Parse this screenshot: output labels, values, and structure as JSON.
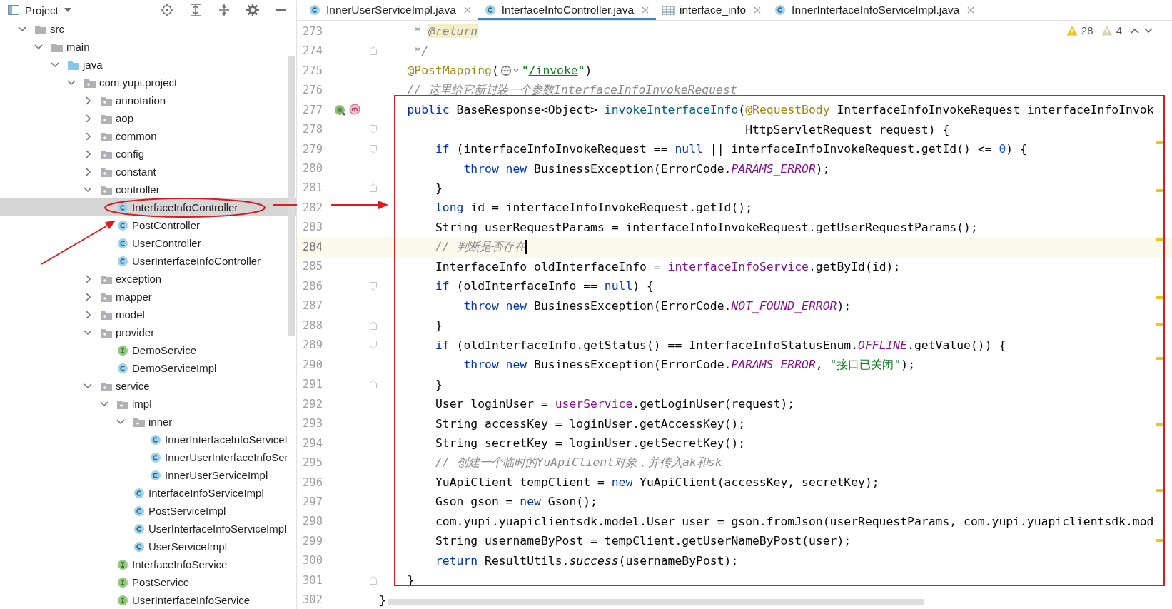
{
  "project_panel": {
    "title": "Project"
  },
  "tree": [
    {
      "label": "src",
      "kind": "folder",
      "expanded": true,
      "selected": false,
      "children": [
        {
          "label": "main",
          "kind": "folder",
          "expanded": true,
          "selected": false,
          "children": [
            {
              "label": "java",
              "kind": "source",
              "expanded": true,
              "selected": false,
              "children": [
                {
                  "label": "com.yupi.project",
                  "kind": "package",
                  "expanded": true,
                  "selected": false,
                  "children": [
                    {
                      "label": "annotation",
                      "kind": "package",
                      "expanded": false,
                      "selected": false
                    },
                    {
                      "label": "aop",
                      "kind": "package",
                      "expanded": false,
                      "selected": false
                    },
                    {
                      "label": "common",
                      "kind": "package",
                      "expanded": false,
                      "selected": false
                    },
                    {
                      "label": "config",
                      "kind": "package",
                      "expanded": false,
                      "selected": false
                    },
                    {
                      "label": "constant",
                      "kind": "package",
                      "expanded": false,
                      "selected": false
                    },
                    {
                      "label": "controller",
                      "kind": "package",
                      "expanded": true,
                      "selected": false,
                      "children": [
                        {
                          "label": "InterfaceInfoController",
                          "kind": "class",
                          "selected": true
                        },
                        {
                          "label": "PostController",
                          "kind": "class",
                          "selected": false
                        },
                        {
                          "label": "UserController",
                          "kind": "class",
                          "selected": false
                        },
                        {
                          "label": "UserInterfaceInfoController",
                          "kind": "class",
                          "selected": false
                        }
                      ]
                    },
                    {
                      "label": "exception",
                      "kind": "package",
                      "expanded": false,
                      "selected": false
                    },
                    {
                      "label": "mapper",
                      "kind": "package",
                      "expanded": false,
                      "selected": false
                    },
                    {
                      "label": "model",
                      "kind": "package",
                      "expanded": false,
                      "selected": false
                    },
                    {
                      "label": "provider",
                      "kind": "package",
                      "expanded": true,
                      "selected": false,
                      "children": [
                        {
                          "label": "DemoService",
                          "kind": "interface",
                          "selected": false
                        },
                        {
                          "label": "DemoServiceImpl",
                          "kind": "class",
                          "selected": false
                        }
                      ]
                    },
                    {
                      "label": "service",
                      "kind": "package",
                      "expanded": true,
                      "selected": false,
                      "children": [
                        {
                          "label": "impl",
                          "kind": "package",
                          "expanded": true,
                          "selected": false,
                          "children": [
                            {
                              "label": "inner",
                              "kind": "package",
                              "expanded": true,
                              "selected": false,
                              "children": [
                                {
                                  "label": "InnerInterfaceInfoServiceI",
                                  "kind": "class",
                                  "selected": false
                                },
                                {
                                  "label": "InnerUserInterfaceInfoSer",
                                  "kind": "class",
                                  "selected": false
                                },
                                {
                                  "label": "InnerUserServiceImpl",
                                  "kind": "class",
                                  "selected": false
                                }
                              ]
                            },
                            {
                              "label": "InterfaceInfoServiceImpl",
                              "kind": "class",
                              "selected": false
                            },
                            {
                              "label": "PostServiceImpl",
                              "kind": "class",
                              "selected": false
                            },
                            {
                              "label": "UserInterfaceInfoServiceImpl",
                              "kind": "class",
                              "selected": false
                            },
                            {
                              "label": "UserServiceImpl",
                              "kind": "class",
                              "selected": false
                            }
                          ]
                        },
                        {
                          "label": "InterfaceInfoService",
                          "kind": "interface",
                          "selected": false
                        },
                        {
                          "label": "PostService",
                          "kind": "interface",
                          "selected": false
                        },
                        {
                          "label": "UserInterfaceInfoService",
                          "kind": "interface",
                          "selected": false
                        }
                      ]
                    }
                  ]
                }
              ]
            }
          ]
        }
      ]
    }
  ],
  "tabs": [
    {
      "label": "InnerUserServiceImpl.java",
      "kind": "class",
      "selected": false
    },
    {
      "label": "InterfaceInfoController.java",
      "kind": "class",
      "selected": true
    },
    {
      "label": "interface_info",
      "kind": "table",
      "selected": false
    },
    {
      "label": "InnerInterfaceInfoServiceImpl.java",
      "kind": "class",
      "selected": false
    }
  ],
  "inspections": {
    "warnings": "28",
    "weak_warnings": "4"
  },
  "editor": {
    "lines": [
      {
        "number": "273",
        "indent": {
          "kind": "doc"
        },
        "current": false,
        "tokens": [
          {
            "kind": "comment",
            "text": "* "
          },
          {
            "kind": "doctag",
            "text": "@return"
          }
        ]
      },
      {
        "number": "274",
        "indent": {
          "kind": "doc"
        },
        "current": false,
        "fold": {
          "kind": "end"
        },
        "tokens": [
          {
            "kind": "comment",
            "text": "*/"
          }
        ]
      },
      {
        "number": "275",
        "indent": {
          "kind": "member"
        },
        "current": false,
        "tokens": [
          {
            "kind": "annotation",
            "text": "@PostMapping"
          },
          {
            "kind": "plain",
            "text": "("
          },
          {
            "kind": "inlay"
          },
          {
            "kind": "string",
            "text": "\""
          },
          {
            "kind": "link",
            "text": "/invoke"
          },
          {
            "kind": "string",
            "text": "\""
          },
          {
            "kind": "plain",
            "text": ")"
          }
        ]
      },
      {
        "number": "276",
        "indent": {
          "kind": "member"
        },
        "current": false,
        "tokens": [
          {
            "kind": "comment",
            "text": "// 这里给它新封装一个参数InterfaceInfoInvokeRequest"
          }
        ]
      },
      {
        "number": "277",
        "indent": {
          "kind": "member"
        },
        "current": false,
        "gutter_icons": [
          {
            "kind": "bean"
          },
          {
            "kind": "mapping"
          }
        ],
        "tokens": [
          {
            "kind": "keyword",
            "text": "public"
          },
          {
            "kind": "plain",
            "text": " BaseResponse<Object> "
          },
          {
            "kind": "decl",
            "text": "invokeInterfaceInfo"
          },
          {
            "kind": "plain",
            "text": "("
          },
          {
            "kind": "annotation",
            "text": "@RequestBody"
          },
          {
            "kind": "plain",
            "text": " InterfaceInfoInvokeRequest interfaceInfoInvok"
          }
        ]
      },
      {
        "number": "278",
        "indent": {
          "kind": "continuation"
        },
        "current": false,
        "fold": {
          "kind": "start"
        },
        "tokens": [
          {
            "kind": "plain",
            "text": "HttpServletRequest request) {"
          }
        ]
      },
      {
        "number": "279",
        "indent": {
          "kind": "body"
        },
        "current": false,
        "fold": {
          "kind": "start"
        },
        "tokens": [
          {
            "kind": "keyword",
            "text": "if"
          },
          {
            "kind": "plain",
            "text": " (interfaceInfoInvokeRequest == "
          },
          {
            "kind": "keyword",
            "text": "null"
          },
          {
            "kind": "plain",
            "text": " || interfaceInfoInvokeRequest.getId() <= "
          },
          {
            "kind": "number",
            "text": "0"
          },
          {
            "kind": "plain",
            "text": ") {"
          }
        ]
      },
      {
        "number": "280",
        "indent": {
          "kind": "nested"
        },
        "current": false,
        "tokens": [
          {
            "kind": "keyword",
            "text": "throw new"
          },
          {
            "kind": "plain",
            "text": " BusinessException(ErrorCode."
          },
          {
            "kind": "constant",
            "text": "PARAMS_ERROR"
          },
          {
            "kind": "plain",
            "text": ");"
          }
        ]
      },
      {
        "number": "281",
        "indent": {
          "kind": "body"
        },
        "current": false,
        "fold": {
          "kind": "end"
        },
        "tokens": [
          {
            "kind": "plain",
            "text": "}"
          }
        ]
      },
      {
        "number": "282",
        "indent": {
          "kind": "body"
        },
        "current": false,
        "tokens": [
          {
            "kind": "keyword",
            "text": "long"
          },
          {
            "kind": "plain",
            "text": " id = interfaceInfoInvokeRequest.getId();"
          }
        ]
      },
      {
        "number": "283",
        "indent": {
          "kind": "body"
        },
        "current": false,
        "tokens": [
          {
            "kind": "plain",
            "text": "String userRequestParams = interfaceInfoInvokeRequest.getUserRequestParams();"
          }
        ]
      },
      {
        "number": "284",
        "indent": {
          "kind": "body"
        },
        "current": true,
        "tokens": [
          {
            "kind": "comment",
            "text": "// 判断是否存在"
          }
        ]
      },
      {
        "number": "285",
        "indent": {
          "kind": "body"
        },
        "current": false,
        "tokens": [
          {
            "kind": "plain",
            "text": "InterfaceInfo oldInterfaceInfo = "
          },
          {
            "kind": "field",
            "text": "interfaceInfoService"
          },
          {
            "kind": "plain",
            "text": ".getById(id);"
          }
        ]
      },
      {
        "number": "286",
        "indent": {
          "kind": "body"
        },
        "current": false,
        "fold": {
          "kind": "start"
        },
        "tokens": [
          {
            "kind": "keyword",
            "text": "if"
          },
          {
            "kind": "plain",
            "text": " (oldInterfaceInfo == "
          },
          {
            "kind": "keyword",
            "text": "null"
          },
          {
            "kind": "plain",
            "text": ") {"
          }
        ]
      },
      {
        "number": "287",
        "indent": {
          "kind": "nested"
        },
        "current": false,
        "tokens": [
          {
            "kind": "keyword",
            "text": "throw new"
          },
          {
            "kind": "plain",
            "text": " BusinessException(ErrorCode."
          },
          {
            "kind": "constant",
            "text": "NOT_FOUND_ERROR"
          },
          {
            "kind": "plain",
            "text": ");"
          }
        ]
      },
      {
        "number": "288",
        "indent": {
          "kind": "body"
        },
        "current": false,
        "fold": {
          "kind": "end"
        },
        "tokens": [
          {
            "kind": "plain",
            "text": "}"
          }
        ]
      },
      {
        "number": "289",
        "indent": {
          "kind": "body"
        },
        "current": false,
        "fold": {
          "kind": "start"
        },
        "tokens": [
          {
            "kind": "keyword",
            "text": "if"
          },
          {
            "kind": "plain",
            "text": " (oldInterfaceInfo.getStatus() == InterfaceInfoStatusEnum."
          },
          {
            "kind": "constant",
            "text": "OFFLINE"
          },
          {
            "kind": "plain",
            "text": ".getValue()) {"
          }
        ]
      },
      {
        "number": "290",
        "indent": {
          "kind": "nested"
        },
        "current": false,
        "tokens": [
          {
            "kind": "keyword",
            "text": "throw new"
          },
          {
            "kind": "plain",
            "text": " BusinessException(ErrorCode."
          },
          {
            "kind": "constant",
            "text": "PARAMS_ERROR"
          },
          {
            "kind": "plain",
            "text": ", "
          },
          {
            "kind": "string",
            "text": "\"接口已关闭\""
          },
          {
            "kind": "plain",
            "text": ");"
          }
        ]
      },
      {
        "number": "291",
        "indent": {
          "kind": "body"
        },
        "current": false,
        "fold": {
          "kind": "end"
        },
        "tokens": [
          {
            "kind": "plain",
            "text": "}"
          }
        ]
      },
      {
        "number": "292",
        "indent": {
          "kind": "body"
        },
        "current": false,
        "tokens": [
          {
            "kind": "plain",
            "text": "User loginUser = "
          },
          {
            "kind": "field",
            "text": "userService"
          },
          {
            "kind": "plain",
            "text": ".getLoginUser(request);"
          }
        ]
      },
      {
        "number": "293",
        "indent": {
          "kind": "body"
        },
        "current": false,
        "tokens": [
          {
            "kind": "plain",
            "text": "String accessKey = loginUser.getAccessKey();"
          }
        ]
      },
      {
        "number": "294",
        "indent": {
          "kind": "body"
        },
        "current": false,
        "tokens": [
          {
            "kind": "plain",
            "text": "String secretKey = loginUser.getSecretKey();"
          }
        ]
      },
      {
        "number": "295",
        "indent": {
          "kind": "body"
        },
        "current": false,
        "tokens": [
          {
            "kind": "comment",
            "text": "// 创建一个临时的YuApiClient对象，并传入ak和sk"
          }
        ]
      },
      {
        "number": "296",
        "indent": {
          "kind": "body"
        },
        "current": false,
        "tokens": [
          {
            "kind": "plain",
            "text": "YuApiClient tempClient = "
          },
          {
            "kind": "keyword",
            "text": "new"
          },
          {
            "kind": "plain",
            "text": " YuApiClient(accessKey, secretKey);"
          }
        ]
      },
      {
        "number": "297",
        "indent": {
          "kind": "body"
        },
        "current": false,
        "tokens": [
          {
            "kind": "plain",
            "text": "Gson gson = "
          },
          {
            "kind": "keyword",
            "text": "new"
          },
          {
            "kind": "plain",
            "text": " Gson();"
          }
        ]
      },
      {
        "number": "298",
        "indent": {
          "kind": "body"
        },
        "current": false,
        "tokens": [
          {
            "kind": "plain",
            "text": "com.yupi.yuapiclientsdk.model.User user = gson.fromJson(userRequestParams, com.yupi.yuapiclientsdk.mod"
          }
        ]
      },
      {
        "number": "299",
        "indent": {
          "kind": "body"
        },
        "current": false,
        "tokens": [
          {
            "kind": "plain",
            "text": "String usernameByPost = tempClient.getUserNameByPost(user);"
          }
        ]
      },
      {
        "number": "300",
        "indent": {
          "kind": "body"
        },
        "current": false,
        "tokens": [
          {
            "kind": "keyword",
            "text": "return"
          },
          {
            "kind": "plain",
            "text": " ResultUtils."
          },
          {
            "kind": "static",
            "text": "success"
          },
          {
            "kind": "plain",
            "text": "(usernameByPost);"
          }
        ]
      },
      {
        "number": "301",
        "indent": {
          "kind": "member"
        },
        "current": false,
        "fold": {
          "kind": "end"
        },
        "tokens": [
          {
            "kind": "plain",
            "text": "}"
          }
        ]
      },
      {
        "number": "302",
        "current": false,
        "tokens": [
          {
            "kind": "plain",
            "text": "}"
          }
        ]
      }
    ]
  }
}
